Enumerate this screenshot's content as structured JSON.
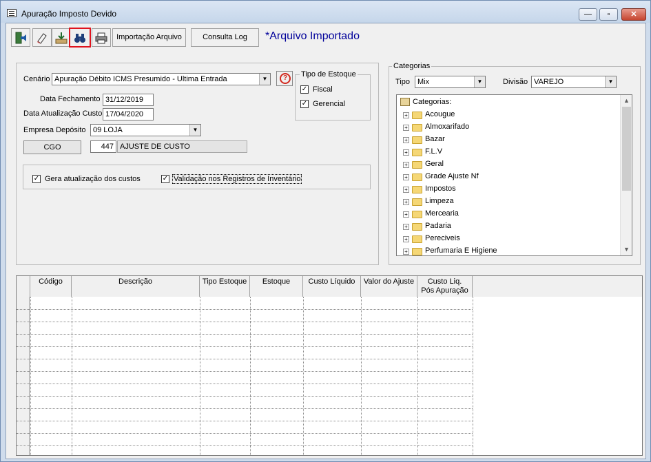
{
  "window": {
    "title": "Apuração Imposto Devido",
    "min_glyph": "—",
    "max_glyph": "▫",
    "close_glyph": "✕"
  },
  "toolbar": {
    "exit_icon": "door-exit-icon",
    "clear_icon": "eraser-icon",
    "save_icon": "tray-download-icon",
    "search_icon": "binoculars-icon",
    "print_icon": "printer-icon",
    "import_label": "Importação Arquivo",
    "log_label": "Consulta Log",
    "status_text": "*Arquivo Importado"
  },
  "form": {
    "cenario_label": "Cenário",
    "cenario_value": "Apuração Débito ICMS Presumido - Ultima Entrada",
    "help_glyph": "?",
    "data_fechamento_label": "Data Fechamento",
    "data_fechamento_value": "31/12/2019",
    "data_atualizacao_label": "Data Atualização Custo",
    "data_atualizacao_value": "17/04/2020",
    "empresa_label": "Empresa Depósito",
    "empresa_value": "09 LOJA",
    "cgo_label": "CGO",
    "cgo_code": "447",
    "cgo_desc": "AJUSTE DE CUSTO",
    "gera_atualizacao_label": "Gera atualização dos custos",
    "validacao_label": "Validação nos Registros de Inventário",
    "check_glyph": "✓"
  },
  "tipo_estoque": {
    "title": "Tipo de Estoque",
    "fiscal_label": "Fiscal",
    "gerencial_label": "Gerencial"
  },
  "categorias": {
    "title": "Categorias",
    "tipo_label": "Tipo",
    "tipo_value": "Mix",
    "divisao_label": "Divisão",
    "divisao_value": "VAREJO",
    "root_label": "Categorias:",
    "items": [
      "Acougue",
      "Almoxarifado",
      "Bazar",
      "F.L.V",
      "Geral",
      "Grade Ajuste Nf",
      "Impostos",
      "Limpeza",
      "Mercearia",
      "Padaria",
      "Pereciveis",
      "Perfumaria E Higiene"
    ]
  },
  "grid": {
    "columns": [
      "Código",
      "Descrição",
      "Tipo Estoque",
      "Estoque",
      "Custo Líquido",
      "Valor do Ajuste",
      "Custo Liq.\nPós Apuração"
    ]
  }
}
